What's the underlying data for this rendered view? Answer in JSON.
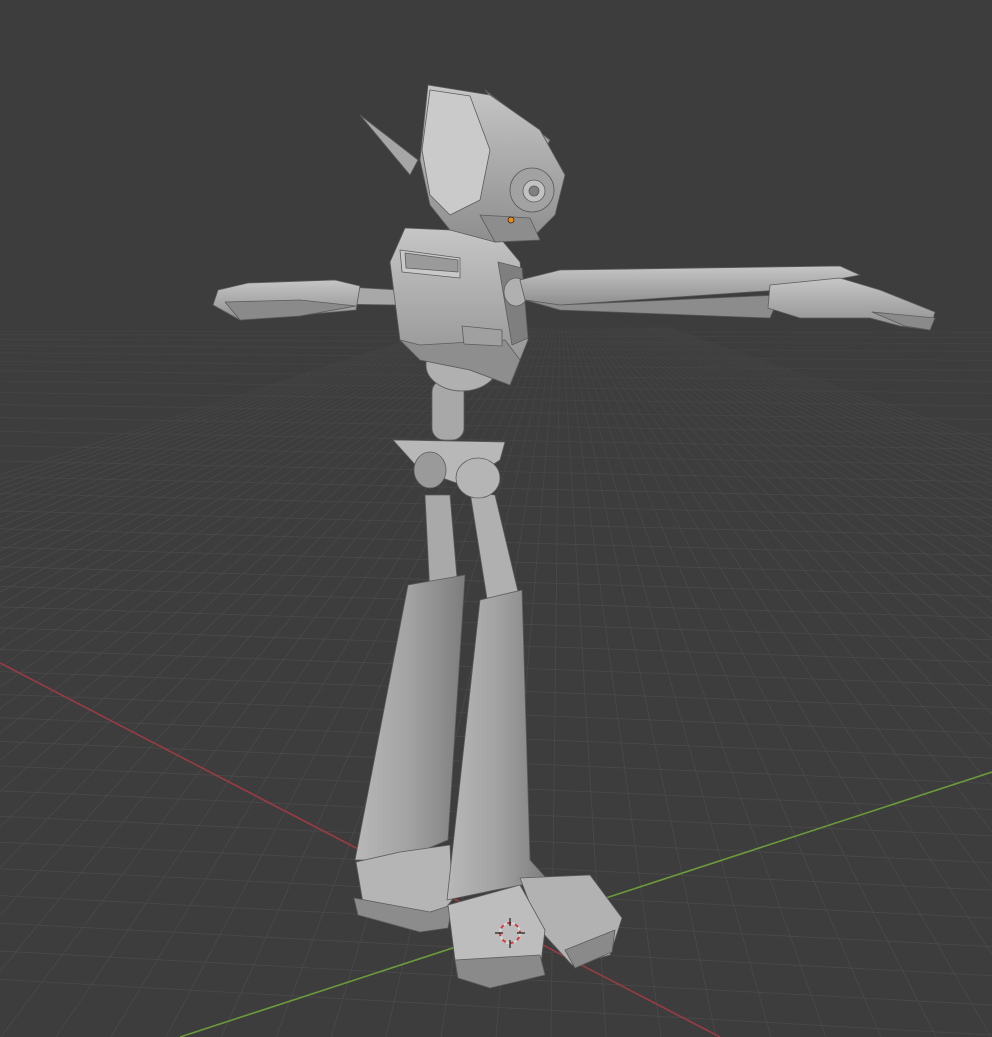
{
  "viewport": {
    "background_color": "#3d3d3d",
    "grid_color": "#4a4a4a",
    "x_axis_color": "#9a3b43",
    "y_axis_color": "#6b9a3b",
    "icons": [
      "3d-cursor-icon",
      "object-origin-icon"
    ]
  },
  "model": {
    "description_name": "robot-character-mesh",
    "pose": "T-pose",
    "shading": "solid",
    "base_color": "#9c9c9c",
    "highlight_color": "#c4c4c4",
    "shadow_color": "#6a6a6a"
  },
  "origin_color": "#f08a1a",
  "cursor_colors": [
    "#d8d8d8",
    "#d83a3a"
  ]
}
